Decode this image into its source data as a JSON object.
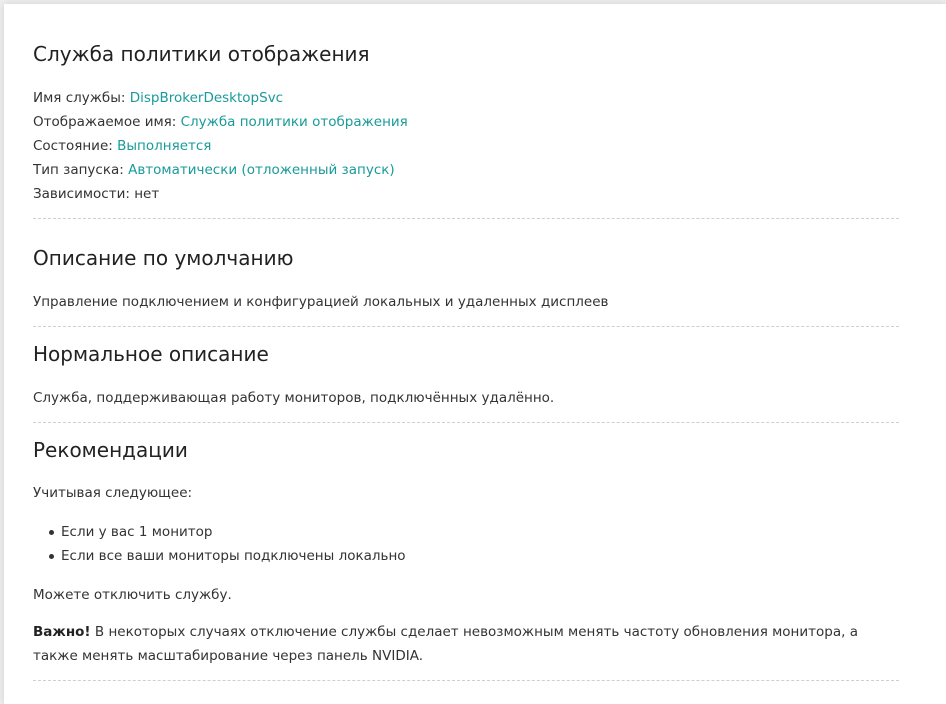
{
  "service": {
    "title": "Служба политики отображения",
    "fields": [
      {
        "label": "Имя службы: ",
        "value": "DispBrokerDesktopSvc"
      },
      {
        "label": "Отображаемое имя: ",
        "value": "Служба политики отображения"
      },
      {
        "label": "Состояние: ",
        "value": "Выполняется"
      },
      {
        "label": "Тип запуска: ",
        "value": "Автоматически (отложенный запуск)"
      },
      {
        "label": "Зависимости: нет",
        "value": ""
      }
    ]
  },
  "default_description": {
    "title": "Описание по умолчанию",
    "text": "Управление подключением и конфигурацией локальных и удаленных дисплеев"
  },
  "normal_description": {
    "title": "Нормальное описание",
    "text": "Служба, поддерживающая работу мониторов, подключённых удалённо."
  },
  "recommendations": {
    "title": "Рекомендации",
    "intro": "Учитывая следующее:",
    "bullets": [
      "Если у вас 1 монитор",
      "Если все ваши мониторы подключены локально"
    ],
    "conclusion": "Можете отключить службу.",
    "important_label": "Важно!",
    "important_text": " В некоторых случаях отключение службы сделает невозможным менять частоту обновления монитора, а также менять масштабирование через панель NVIDIA."
  },
  "colors": {
    "accent": "#1a9a9a",
    "text": "#333333",
    "separator": "#cfcfcf"
  }
}
